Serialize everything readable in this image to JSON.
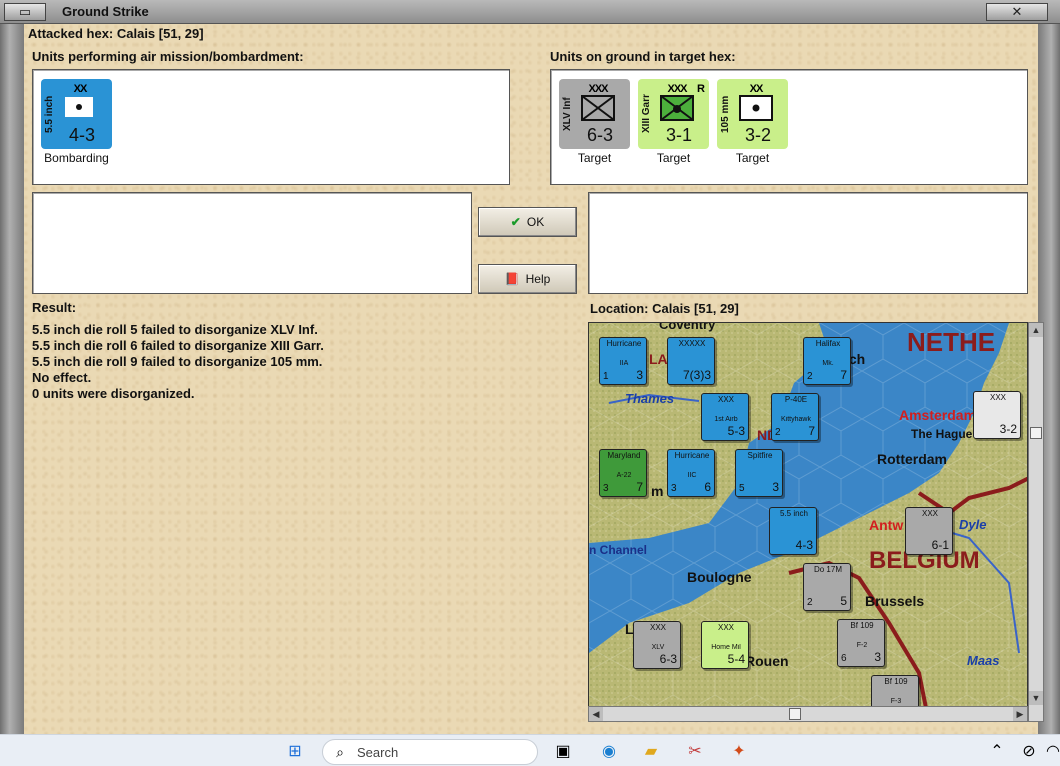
{
  "window": {
    "title": "Ground Strike",
    "attacked_hex": "Attacked hex: Calais  [51, 29]"
  },
  "air_units": {
    "label": "Units performing air mission/bombardment:",
    "items": [
      {
        "side_text": "5.5 inch",
        "size": "XX",
        "values": "4-3",
        "caption": "Bombarding",
        "color": "#2a93d5"
      }
    ]
  },
  "ground_units": {
    "label": "Units on ground in target hex:",
    "items": [
      {
        "side_text": "XLV Inf",
        "size": "XXX",
        "tag": "",
        "values": "6-3",
        "caption": "Target",
        "color": "#a9a9a9",
        "symbol": "infantry"
      },
      {
        "side_text": "XIII Garr",
        "size": "XXX",
        "tag": "R",
        "values": "3-1",
        "caption": "Target",
        "color": "#c9ef8a",
        "symbol": "garrison"
      },
      {
        "side_text": "105 mm",
        "size": "XX",
        "tag": "",
        "values": "3-2",
        "caption": "Target",
        "color": "#c9ef8a",
        "symbol": "artillery"
      }
    ]
  },
  "buttons": {
    "ok_label": "OK",
    "help_label": "Help"
  },
  "result": {
    "label": "Result:",
    "lines": [
      "5.5 inch die roll 5 failed to disorganize XLV Inf.",
      "5.5 inch die roll 6 failed to disorganize XIII Garr.",
      "5.5 inch die roll 9 failed to disorganize 105 mm.",
      "No effect.",
      "0 units were disorganized."
    ]
  },
  "location": {
    "label": "Location:  Calais  [51, 29]"
  },
  "map": {
    "labels": {
      "nether": "NETHE",
      "amsterdam": "Amsterdam",
      "hague": "The Hague",
      "rotterdam": "Rotterdam",
      "thames": "Thames",
      "channel": "n Channel",
      "boulogne": "Boulogne",
      "belgium": "BELGIUM",
      "brussels": "Brussels",
      "antw": "Antw",
      "dyle": "Dyle",
      "maas": "Maas",
      "coventry": "Coventry",
      "rouen": "Rouen",
      "ich": "ich",
      "la": "LA",
      "nd": "ND",
      "m": "m",
      "le": "Le"
    },
    "counters": [
      {
        "top": "Hurricane",
        "sub": "IIA",
        "bl": "1",
        "br": "3",
        "color": "#2a93d5",
        "name": "hurricane-counter"
      },
      {
        "top": "XXXXX",
        "sub": "",
        "bl": "",
        "br": "7(3)3",
        "color": "#2a93d5",
        "name": "army-counter"
      },
      {
        "top": "Halifax",
        "sub": "Mk.",
        "bl": "2",
        "br": "7",
        "color": "#2a93d5",
        "name": "halifax-counter"
      },
      {
        "top": "XXX",
        "sub": "1st Airb",
        "bl": "",
        "br": "5-3",
        "color": "#2a93d5",
        "name": "airborne-counter"
      },
      {
        "top": "P-40E",
        "sub": "Kittyhawk",
        "bl": "2",
        "br": "7",
        "color": "#2a93d5",
        "name": "kittyhawk-counter"
      },
      {
        "top": "Maryland",
        "sub": "A-22",
        "bl": "3",
        "br": "7",
        "color": "#3f9a3a",
        "name": "maryland-counter"
      },
      {
        "top": "Hurricane",
        "sub": "IIC",
        "bl": "3",
        "br": "6",
        "color": "#2a93d5",
        "name": "hurricane-iic-counter"
      },
      {
        "top": "Spitfire",
        "sub": "",
        "bl": "5",
        "br": "3",
        "color": "#2a93d5",
        "name": "spitfire-counter"
      },
      {
        "top": "5.5 inch",
        "sub": "",
        "bl": "",
        "br": "4-3",
        "color": "#2a93d5",
        "name": "bombard-counter"
      },
      {
        "top": "XXX",
        "sub": "",
        "bl": "",
        "br": "6-1",
        "color": "#a9a9a9",
        "name": "german-corps-counter"
      },
      {
        "top": "Do 17M",
        "sub": "",
        "bl": "2",
        "br": "5",
        "color": "#a9a9a9",
        "name": "do17-counter"
      },
      {
        "top": "Bf 109",
        "sub": "F-2",
        "bl": "6",
        "br": "3",
        "color": "#a9a9a9",
        "name": "bf109-f2-counter"
      },
      {
        "top": "XXX",
        "sub": "XLV",
        "bl": "",
        "br": "6-3",
        "color": "#a9a9a9",
        "name": "xlv-counter"
      },
      {
        "top": "XXX",
        "sub": "Home Mil",
        "bl": "",
        "br": "5-4",
        "color": "#c9ef8a",
        "name": "home-mil-counter"
      },
      {
        "top": "Bf 109",
        "sub": "F-3",
        "bl": "6",
        "br": "",
        "color": "#a9a9a9",
        "name": "bf109-f3-counter"
      },
      {
        "top": "XXX",
        "sub": "",
        "bl": "",
        "br": "3-2",
        "color": "#e8e8e8",
        "name": "dutch-counter"
      }
    ]
  },
  "taskbar": {
    "search_text": "Search"
  }
}
